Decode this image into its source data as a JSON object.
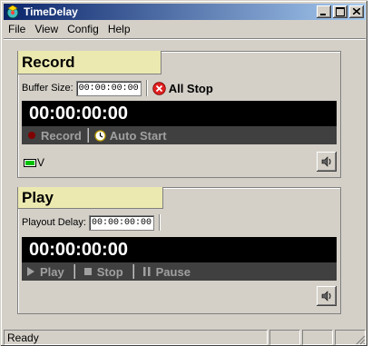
{
  "window": {
    "title": "TimeDelay",
    "colors": {
      "titlebar_start": "#0a246a",
      "titlebar_end": "#a6caf0",
      "face": "#d4d0c8",
      "panel_tab": "#ece9b0"
    }
  },
  "menu": {
    "items": [
      {
        "label": "File",
        "icon": ""
      },
      {
        "label": "View",
        "icon": ""
      },
      {
        "label": "Config",
        "icon": ""
      },
      {
        "label": "Help",
        "icon": ""
      }
    ]
  },
  "record": {
    "title": "Record",
    "buffer_label": "Buffer Size:",
    "buffer_value": "00:00:00:00",
    "all_stop_label": "All Stop",
    "all_stop_icon": "stop-circle-icon",
    "timecode": "00:00:00:00",
    "record_label": "Record",
    "record_icon": "record-dot-icon",
    "auto_start_label": "Auto Start",
    "auto_start_icon": "clock-icon",
    "vu_label": "V",
    "vu_icon": "vu-meter-icon",
    "speaker_icon": "speaker-icon"
  },
  "play": {
    "title": "Play",
    "playout_label": "Playout Delay:",
    "playout_value": "00:00:00:00",
    "timecode": "00:00:00:00",
    "play_label": "Play",
    "play_icon": "play-triangle-icon",
    "stop_label": "Stop",
    "stop_icon": "stop-square-icon",
    "pause_label": "Pause",
    "pause_icon": "pause-bars-icon",
    "speaker_icon": "speaker-icon"
  },
  "status": {
    "text": "Ready"
  }
}
